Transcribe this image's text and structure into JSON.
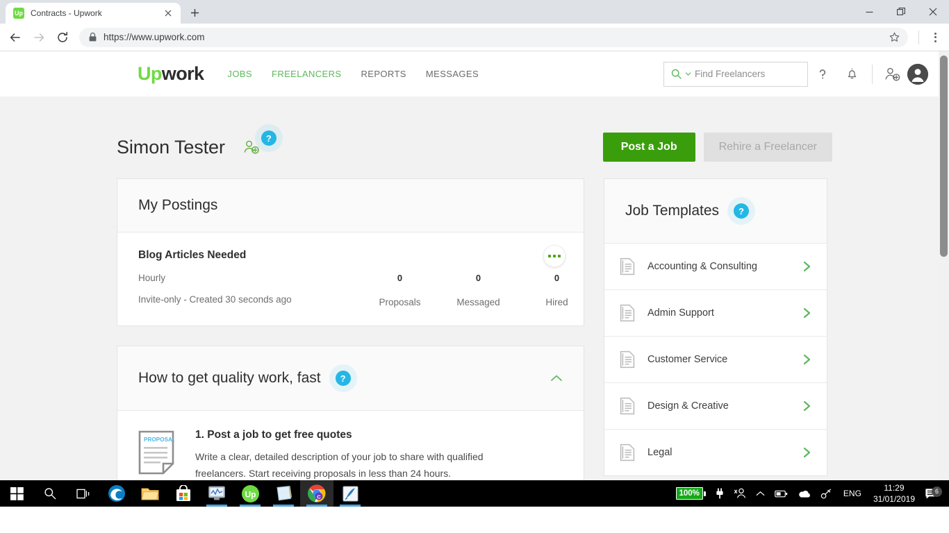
{
  "browser": {
    "tab": {
      "title": "Contracts - Upwork",
      "favicon_text": "Up",
      "close_icon": "close-icon"
    },
    "new_tab_label": "+",
    "window": {
      "minimize": "minimize-icon",
      "maximize": "restore-icon",
      "close": "close-icon"
    },
    "toolbar": {
      "back": "back-arrow-icon",
      "forward": "forward-arrow-icon",
      "reload": "reload-icon",
      "lock": "lock-icon",
      "url": "https://www.upwork.com",
      "bookmark": "star-icon",
      "menu": "kebab-menu-icon"
    }
  },
  "nav": {
    "logo_up": "Up",
    "logo_work": "work",
    "links": [
      {
        "label": "JOBS",
        "active": true
      },
      {
        "label": "FREELANCERS",
        "active": true
      },
      {
        "label": "REPORTS",
        "active": false
      },
      {
        "label": "MESSAGES",
        "active": false
      }
    ],
    "search": {
      "placeholder": "Find Freelancers",
      "icon": "search-icon",
      "caret": "chevron-down-icon"
    },
    "help_icon": "question-mark-icon",
    "bell_icon": "bell-icon",
    "invite_icon": "add-person-icon",
    "avatar_icon": "user-avatar-icon"
  },
  "header": {
    "username": "Simon Tester",
    "invite_icon": "add-person-icon",
    "help_badge": "?",
    "post_job_label": "Post a Job",
    "rehire_label": "Rehire a Freelancer"
  },
  "my_postings": {
    "title": "My Postings",
    "more_icon": "more-options-icon",
    "posting": {
      "title": "Blog Articles Needed",
      "type": "Hourly",
      "subtitle": "Invite-only - Created 30 seconds ago",
      "stats": [
        {
          "value": "0",
          "label": "Proposals"
        },
        {
          "value": "0",
          "label": "Messaged"
        },
        {
          "value": "0",
          "label": "Hired"
        }
      ]
    }
  },
  "quality_work": {
    "title": "How to get quality work, fast",
    "help_badge": "?",
    "collapse_icon": "chevron-up-icon",
    "step": {
      "icon_label": "PROPOSAL",
      "title": "1. Post a job to get free quotes",
      "body": "Write a clear, detailed description of your job to share with qualified freelancers. Start receiving proposals in less than 24 hours."
    }
  },
  "job_templates": {
    "title": "Job Templates",
    "help_badge": "?",
    "items": [
      {
        "label": "Accounting & Consulting"
      },
      {
        "label": "Admin Support"
      },
      {
        "label": "Customer Service"
      },
      {
        "label": "Design & Creative"
      },
      {
        "label": "Legal"
      }
    ]
  },
  "taskbar": {
    "items": [
      {
        "name": "start-button",
        "running": false
      },
      {
        "name": "search-button",
        "running": false
      },
      {
        "name": "task-view-button",
        "running": false
      },
      {
        "name": "edge-icon",
        "running": false
      },
      {
        "name": "file-explorer-icon",
        "running": false
      },
      {
        "name": "microsoft-store-icon",
        "running": false
      },
      {
        "name": "monitor-app-icon",
        "running": true
      },
      {
        "name": "upwork-app-icon",
        "running": true
      },
      {
        "name": "sticky-notes-icon",
        "running": true
      },
      {
        "name": "chrome-icon",
        "running": true,
        "active": true
      },
      {
        "name": "photo-editor-icon",
        "running": true
      }
    ],
    "tray": {
      "battery_percent": "100%",
      "plug_icon": "power-plug-icon",
      "people_icon": "people-icon",
      "show_hidden_icon": "chevron-up-icon",
      "onedrive_icon": "onedrive-icon",
      "battery_tray_icon": "battery-icon",
      "network_icon": "network-icon",
      "language": "ENG",
      "time": "11:29",
      "date": "31/01/2019",
      "notification_count": "6",
      "notification_icon": "action-center-icon"
    }
  },
  "colors": {
    "upwork_green": "#6fda44",
    "button_green": "#3a9e0c",
    "link_green": "#5cb85c",
    "help_blue": "#23b7e5",
    "page_bg": "#f2f2f2"
  }
}
